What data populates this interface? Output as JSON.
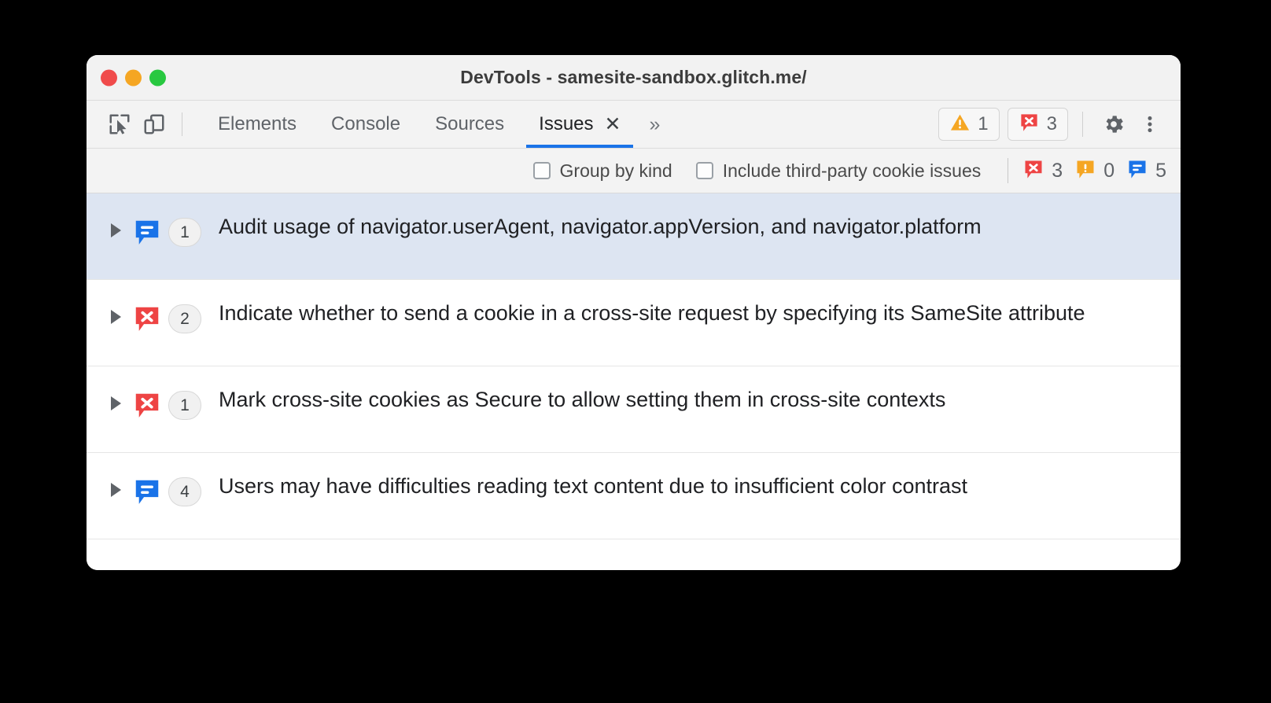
{
  "window": {
    "title": "DevTools - samesite-sandbox.glitch.me/",
    "traffic_lights": [
      "close",
      "minimize",
      "zoom"
    ]
  },
  "toolbar": {
    "inspect_icon": "inspect-cursor-icon",
    "device_icon": "device-toolbar-icon",
    "tabs": [
      {
        "label": "Elements",
        "active": false,
        "closable": false
      },
      {
        "label": "Console",
        "active": false,
        "closable": false
      },
      {
        "label": "Sources",
        "active": false,
        "closable": false
      },
      {
        "label": "Issues",
        "active": true,
        "closable": true
      }
    ],
    "tab_close_glyph": "✕",
    "more_tabs_glyph": "»",
    "warning_chip": {
      "icon": "warning-triangle-icon",
      "count": "1",
      "color": "#f5a623"
    },
    "error_chip": {
      "icon": "error-bubble-icon",
      "count": "3",
      "color": "#ee4444"
    },
    "settings_icon": "gear-icon",
    "menu_icon": "kebab-menu-icon"
  },
  "filters": {
    "checkboxes": [
      {
        "label": "Group by kind",
        "checked": false
      },
      {
        "label": "Include third-party cookie issues",
        "checked": false
      }
    ],
    "badges": [
      {
        "icon": "error-bubble-icon",
        "count": "3",
        "color": "#ee4444"
      },
      {
        "icon": "warning-bubble-icon",
        "count": "0",
        "color": "#f5a623"
      },
      {
        "icon": "info-bubble-icon",
        "count": "5",
        "color": "#1a73e8"
      }
    ]
  },
  "issues": [
    {
      "severity": "info",
      "icon": "info-bubble-icon",
      "color": "#1a73e8",
      "count": "1",
      "title": "Audit usage of navigator.userAgent, navigator.appVersion, and navigator.platform",
      "selected": true,
      "expanded": false
    },
    {
      "severity": "error",
      "icon": "error-bubble-icon",
      "color": "#ee4444",
      "count": "2",
      "title": "Indicate whether to send a cookie in a cross-site request by specifying its SameSite attribute",
      "selected": false,
      "expanded": false
    },
    {
      "severity": "error",
      "icon": "error-bubble-icon",
      "color": "#ee4444",
      "count": "1",
      "title": "Mark cross-site cookies as Secure to allow setting them in cross-site contexts",
      "selected": false,
      "expanded": false
    },
    {
      "severity": "info",
      "icon": "info-bubble-icon",
      "color": "#1a73e8",
      "count": "4",
      "title": "Users may have difficulties reading text content due to insufficient color contrast",
      "selected": false,
      "expanded": false
    }
  ],
  "colors": {
    "accent": "#1a73e8",
    "error": "#ee4444",
    "warning": "#f5a623",
    "selection": "#dde5f2",
    "chrome": "#f3f3f3"
  }
}
